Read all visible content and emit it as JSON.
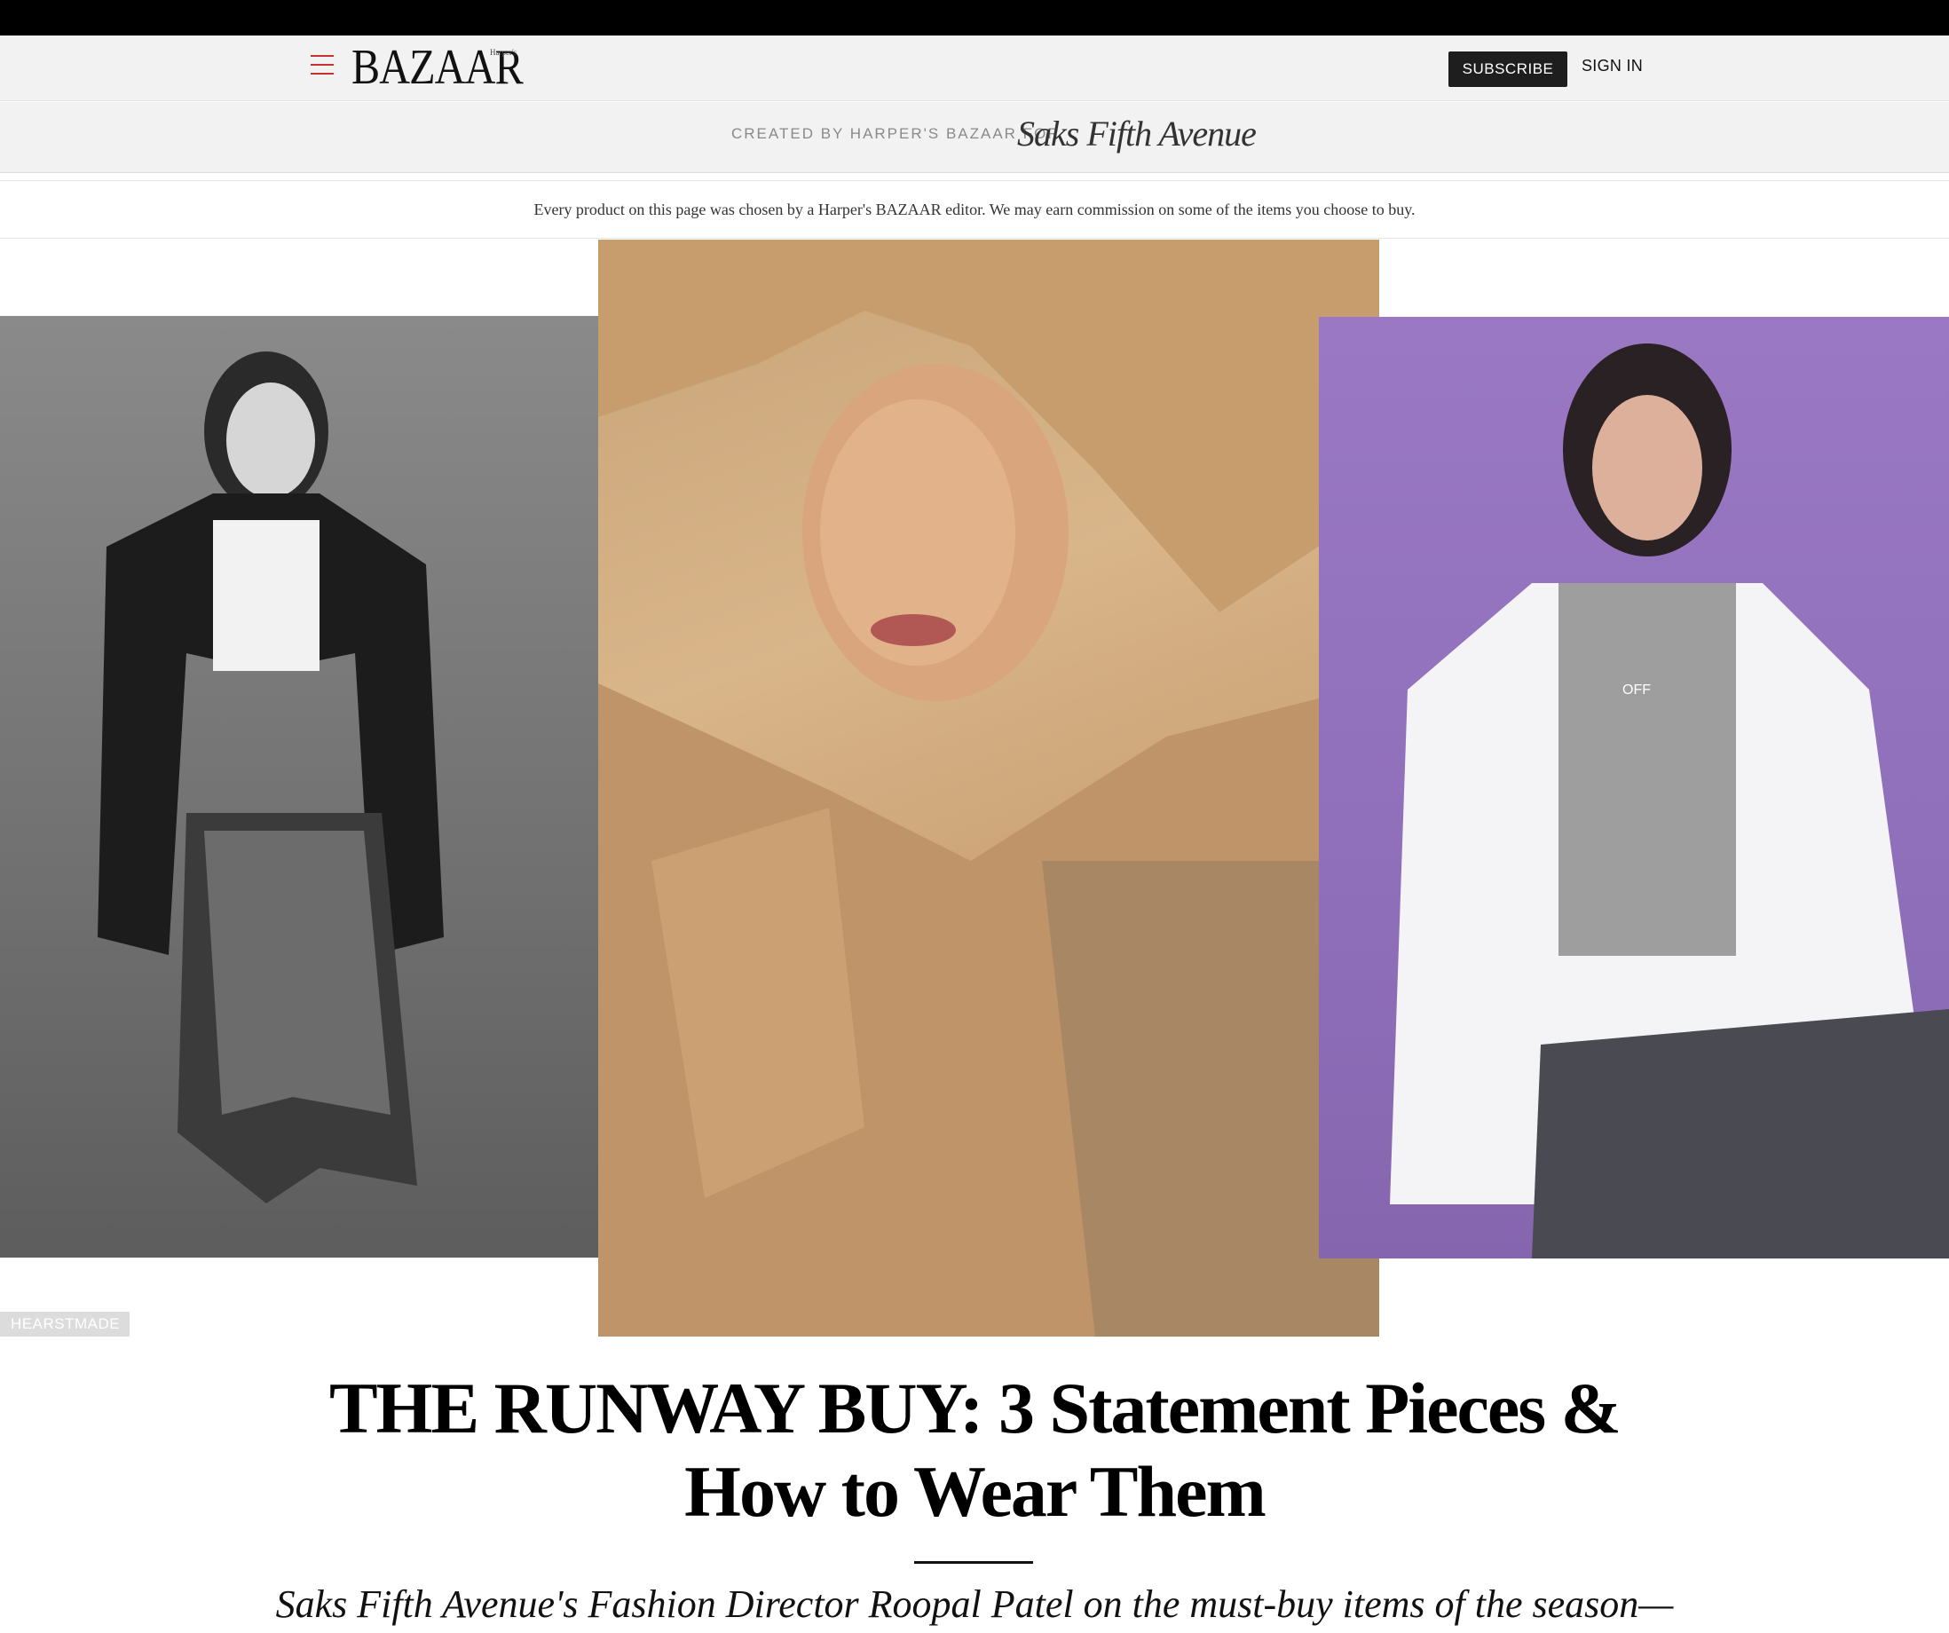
{
  "header": {
    "logo": "BAZAAR",
    "logo_small": "Harper's",
    "subscribe_label": "SUBSCRIBE",
    "signin_label": "SIGN IN"
  },
  "sponsor": {
    "text": "CREATED BY HARPER'S BAZAAR FOR",
    "partner_logo": "Saks Fifth Avenue"
  },
  "disclaimer": "Every product on this page was chosen by a Harper's BAZAAR editor. We may earn commission on some of the items you choose to buy.",
  "hero": {
    "badge": "HEARSTMADE",
    "images": [
      {
        "name": "model-leather-jacket-photo"
      },
      {
        "name": "model-trench-coat-photo"
      },
      {
        "name": "model-white-parka-photo"
      }
    ]
  },
  "article": {
    "headline": "THE RUNWAY BUY: 3 Statement Pieces & How to Wear Them",
    "dek": "Saks Fifth Avenue's Fashion Director Roopal Patel on the must-buy items of the season—"
  },
  "colors": {
    "accent": "#c8322c",
    "subscribe_bg": "#1e1e1e",
    "topbar": "#000000"
  },
  "icons": {
    "menu": "hamburger-menu-icon"
  }
}
